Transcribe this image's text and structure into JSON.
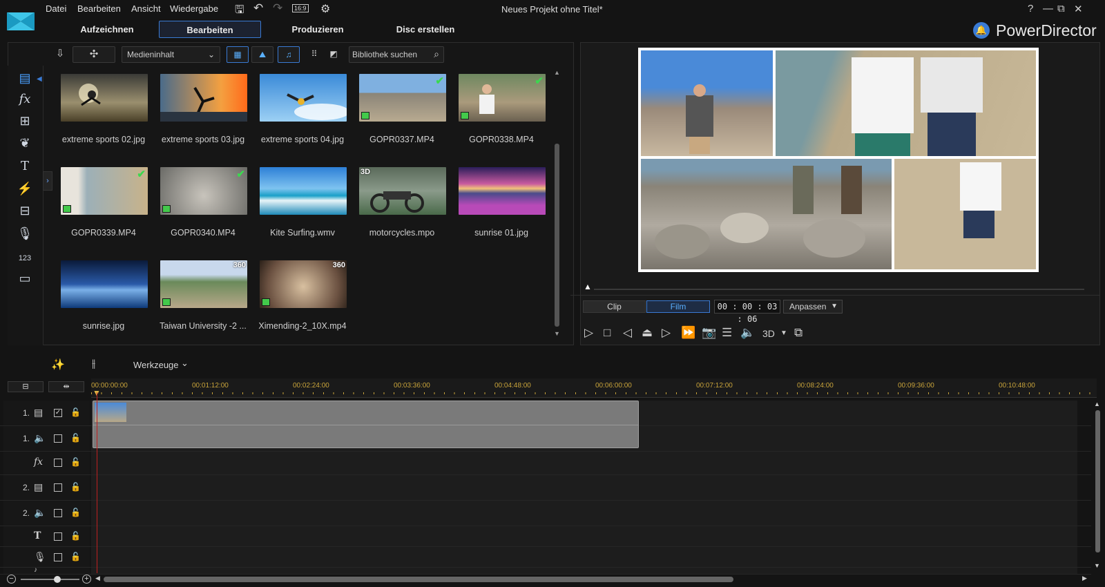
{
  "menu": {
    "items": [
      "Datei",
      "Bearbeiten",
      "Ansicht",
      "Wiedergabe"
    ],
    "aspect": "16:9",
    "title": "Neues Projekt ohne Titel*"
  },
  "window": {
    "help": "?",
    "minimize": "—",
    "restore": "⧉",
    "close": "✕"
  },
  "tabs": [
    "Aufzeichnen",
    "Bearbeiten",
    "Produzieren",
    "Disc erstellen"
  ],
  "brand": {
    "name": "PowerDirector",
    "color": "#3a7bd5"
  },
  "library": {
    "dropdown": "Medieninhalt",
    "search_placeholder": "Bibliothek suchen",
    "items": [
      {
        "label": "extreme sports 02.jpg"
      },
      {
        "label": "extreme sports 03.jpg"
      },
      {
        "label": "extreme sports 04.jpg"
      },
      {
        "label": "GOPR0337.MP4",
        "used": true
      },
      {
        "label": "GOPR0338.MP4",
        "used": true
      },
      {
        "label": "GOPR0339.MP4",
        "used": true
      },
      {
        "label": "GOPR0340.MP4",
        "used": true
      },
      {
        "label": "Kite Surfing.wmv"
      },
      {
        "label": "motorcycles.mpo",
        "badge": "3D"
      },
      {
        "label": "sunrise 01.jpg"
      },
      {
        "label": "sunrise.jpg"
      },
      {
        "label": "Taiwan University -2 ...",
        "badge": "360"
      },
      {
        "label": "Ximending-2_10X.mp4",
        "badge": "360"
      }
    ]
  },
  "preview": {
    "clip": "Clip",
    "film": "Film",
    "timecode": "00 : 00 : 03 : 06",
    "fit": "Anpassen",
    "three_d": "3D"
  },
  "timeline": {
    "tools": "Werkzeuge",
    "ticks": [
      "00:00:00:00",
      "00:01:12:00",
      "00:02:24:00",
      "00:03:36:00",
      "00:04:48:00",
      "00:06:00:00",
      "00:07:12:00",
      "00:08:24:00",
      "00:09:36:00",
      "00:10:48:00"
    ],
    "tracks": [
      {
        "num": "1.",
        "icon": "video-track-icon"
      },
      {
        "num": "1.",
        "icon": "audio-track-icon"
      },
      {
        "num": "",
        "icon": "fx-track-icon"
      },
      {
        "num": "2.",
        "icon": "video-track-icon"
      },
      {
        "num": "2.",
        "icon": "audio-track-icon"
      },
      {
        "num": "",
        "icon": "title-track-icon"
      },
      {
        "num": "",
        "icon": "voice-track-icon"
      },
      {
        "num": "",
        "icon": "music-track-icon"
      }
    ]
  }
}
